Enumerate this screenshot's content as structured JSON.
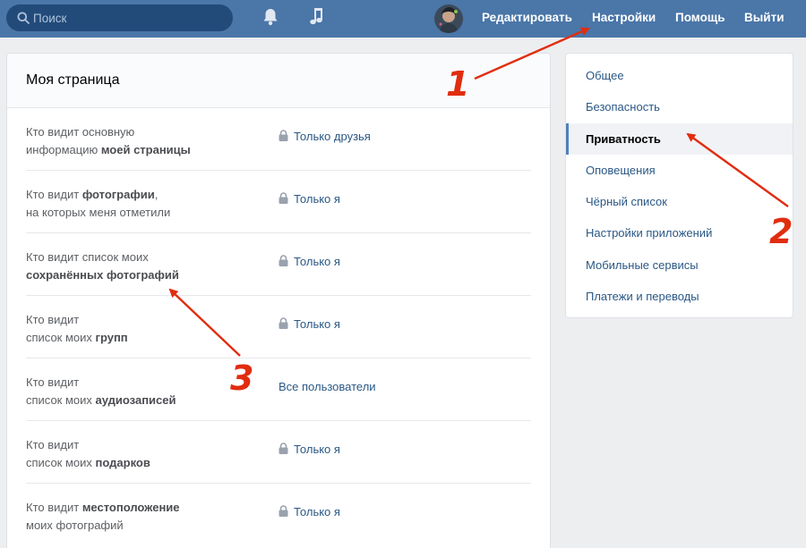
{
  "header": {
    "search_placeholder": "Поиск",
    "nav": {
      "edit": "Редактировать",
      "settings": "Настройки",
      "help": "Помощь",
      "logout": "Выйти"
    }
  },
  "main": {
    "title": "Моя страница",
    "rows": [
      {
        "label_parts": [
          "Кто видит основную",
          "информацию ",
          "моей страницы"
        ],
        "value": "Только друзья",
        "locked": true
      },
      {
        "label_parts": [
          "Кто видит ",
          "фотографии",
          ",",
          "на которых меня отметили"
        ],
        "value": "Только я",
        "locked": true
      },
      {
        "label_parts": [
          "Кто видит список моих",
          "сохранённых фотографий"
        ],
        "value": "Только я",
        "locked": true
      },
      {
        "label_parts": [
          "Кто видит",
          "список моих ",
          "групп"
        ],
        "value": "Только я",
        "locked": true
      },
      {
        "label_parts": [
          "Кто видит",
          "список моих ",
          "аудиозаписей"
        ],
        "value": "Все пользователи",
        "locked": false
      },
      {
        "label_parts": [
          "Кто видит",
          "список моих ",
          "подарков"
        ],
        "value": "Только я",
        "locked": true
      },
      {
        "label_parts": [
          "Кто видит ",
          "местоположение",
          "моих фотографий"
        ],
        "value": "Только я",
        "locked": true
      }
    ]
  },
  "sidebar": {
    "items": [
      {
        "label": "Общее",
        "active": false
      },
      {
        "label": "Безопасность",
        "active": false
      },
      {
        "label": "Приватность",
        "active": true
      },
      {
        "label": "Оповещения",
        "active": false
      },
      {
        "label": "Чёрный список",
        "active": false
      },
      {
        "label": "Настройки приложений",
        "active": false
      },
      {
        "label": "Мобильные сервисы",
        "active": false
      },
      {
        "label": "Платежи и переводы",
        "active": false
      }
    ]
  },
  "annotations": {
    "one": "1",
    "two": "2",
    "three": "3",
    "color": "#e12d0f"
  },
  "colors": {
    "header_bg": "#4a76a8",
    "link": "#2a5885",
    "page_bg": "#edeef0"
  },
  "icons": [
    "search-icon",
    "bell-icon",
    "music-note-icon",
    "lock-icon"
  ]
}
